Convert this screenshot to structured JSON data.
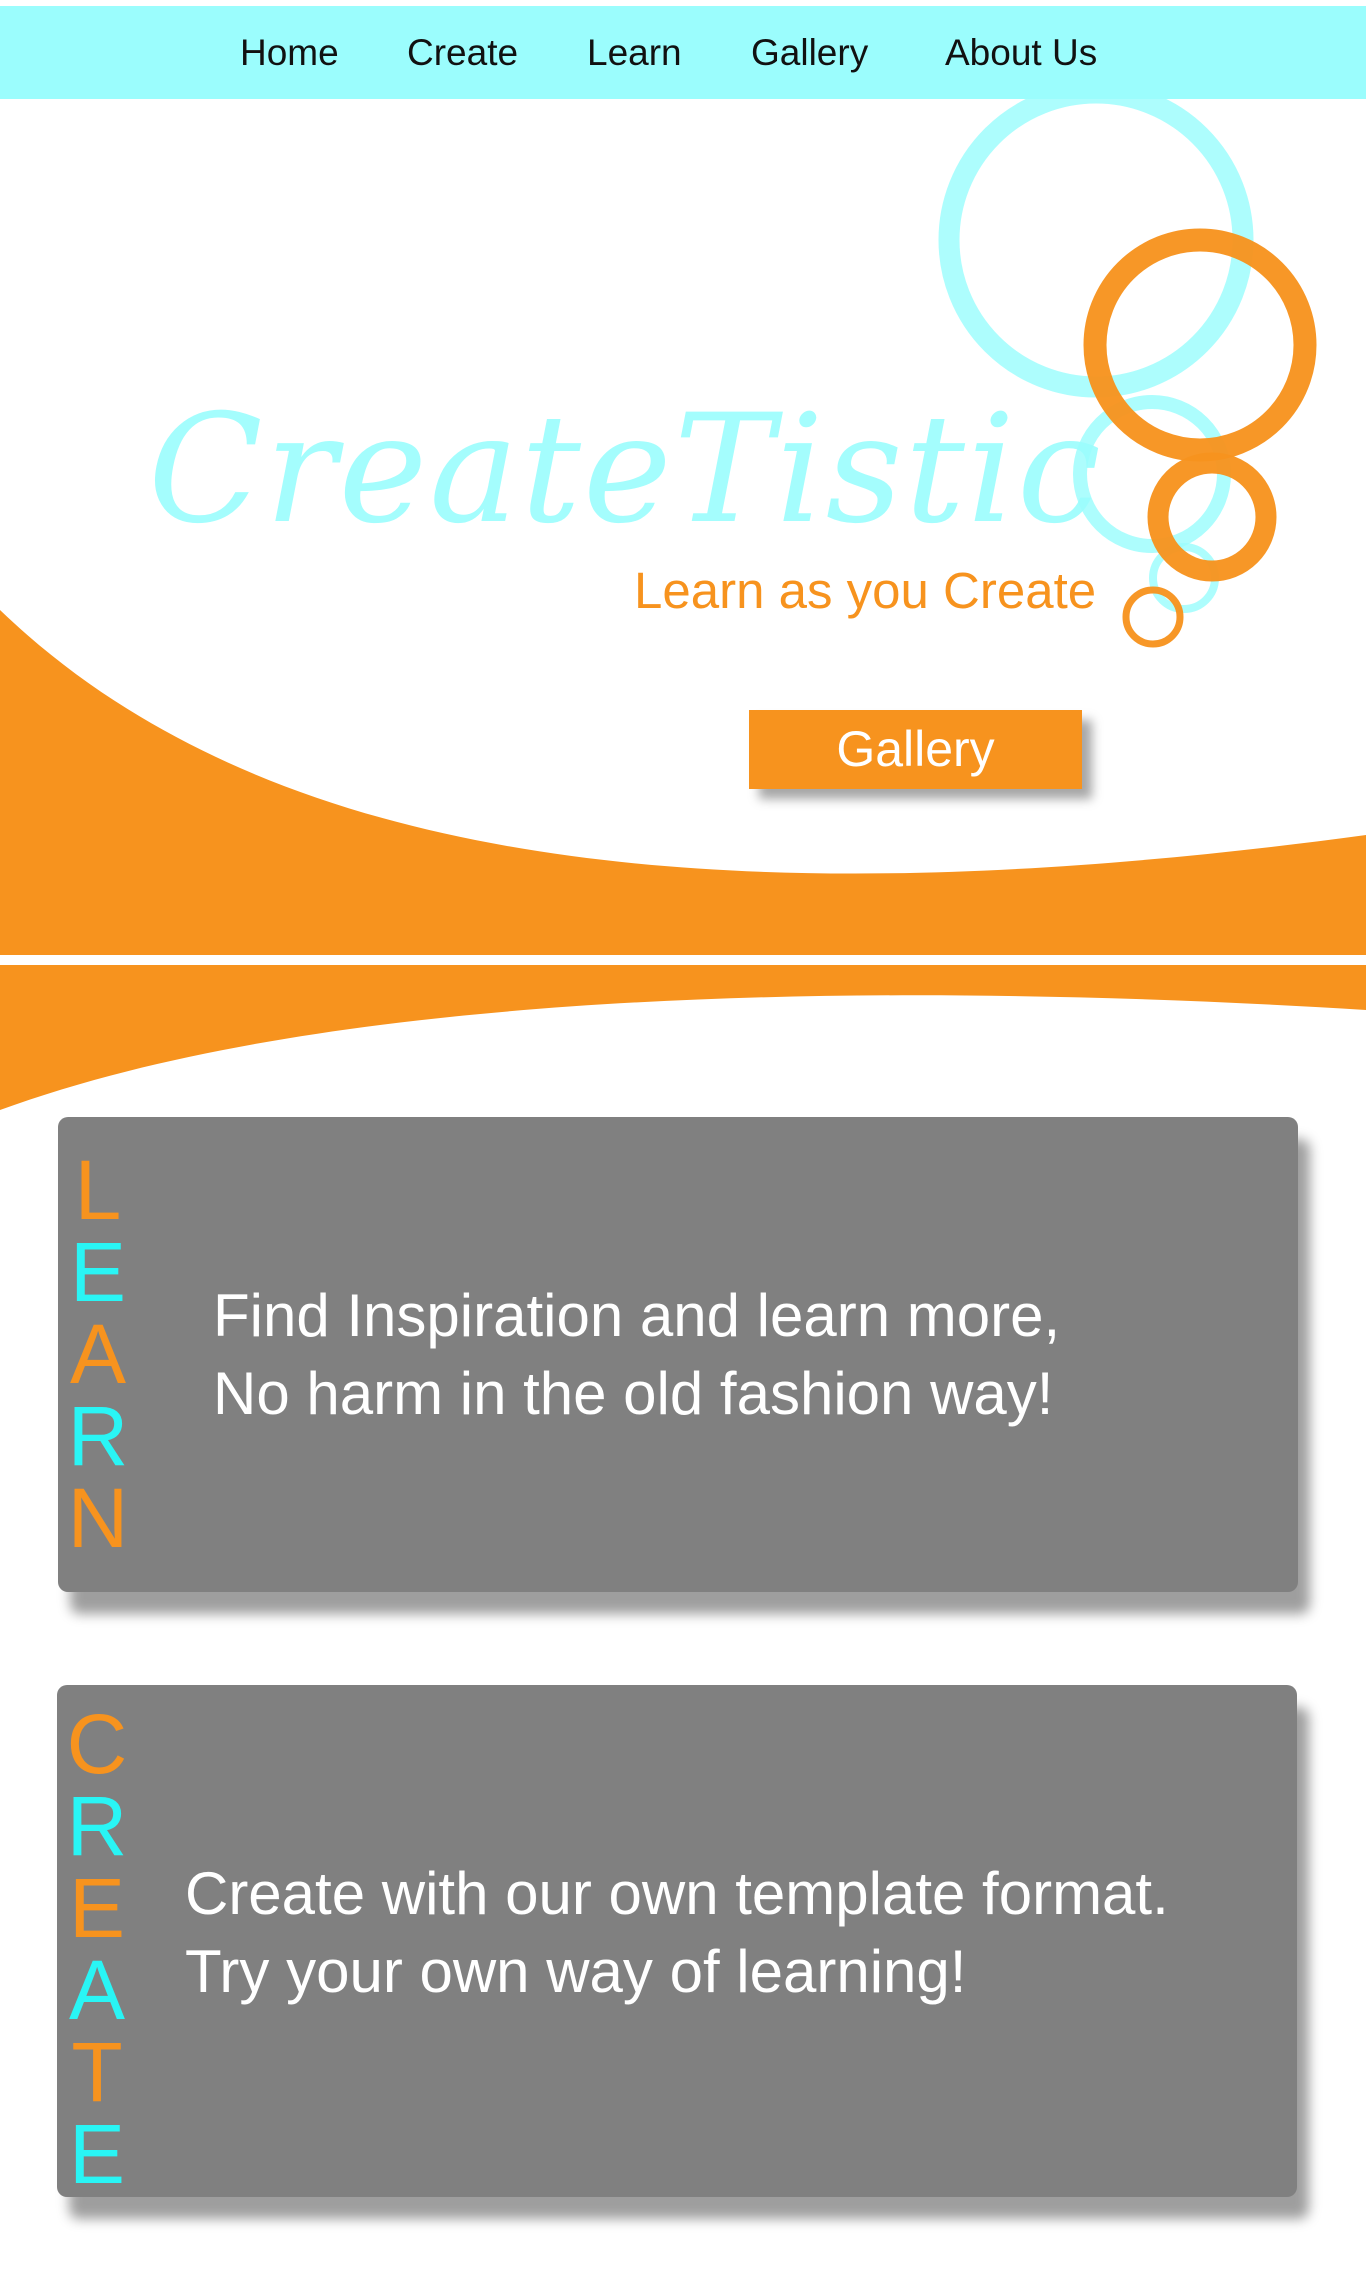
{
  "nav": {
    "items": [
      "Home",
      "Create",
      "Learn",
      "Gallery",
      "About Us"
    ]
  },
  "hero": {
    "logo_text": "CreateTistic",
    "tagline": "Learn as you Create",
    "button_label": "Gallery"
  },
  "sections": [
    {
      "vertical_word": [
        "L",
        "E",
        "A",
        "R",
        "N"
      ],
      "line1": "Find Inspiration and learn more,",
      "line2": "No harm in the old fashion way!"
    },
    {
      "vertical_word": [
        "C",
        "R",
        "E",
        "A",
        "T",
        "E"
      ],
      "line1": "Create with our own template format.",
      "line2": "Try your own way of learning!"
    }
  ],
  "colors": {
    "cyan": "#9bfdfd",
    "letter_cyan": "#29f5f5",
    "orange": "#f7931e",
    "card_gray": "#808080"
  }
}
